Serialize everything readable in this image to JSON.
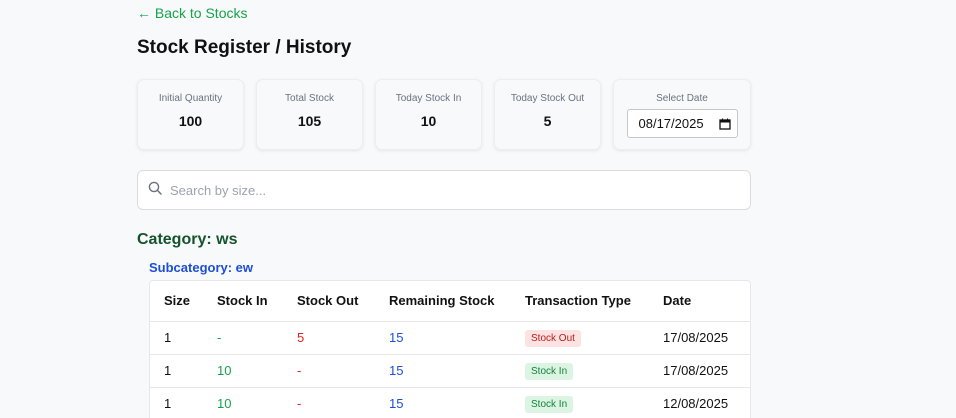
{
  "nav": {
    "back_label": "← Back to Stocks"
  },
  "page": {
    "title": "Stock Register / History"
  },
  "stats": [
    {
      "label": "Initial Quantity",
      "value": "100"
    },
    {
      "label": "Total Stock",
      "value": "105"
    },
    {
      "label": "Today Stock In",
      "value": "10"
    },
    {
      "label": "Today Stock Out",
      "value": "5"
    }
  ],
  "date_picker": {
    "label": "Select Date",
    "value": "08/17/2025",
    "icon": "calendar-icon"
  },
  "search": {
    "placeholder": "Search by size...",
    "icon": "search-icon"
  },
  "category": {
    "label": "Category: ws"
  },
  "subcategory": {
    "label": "Subcategory: ew"
  },
  "table": {
    "headers": [
      "Size",
      "Stock In",
      "Stock Out",
      "Remaining Stock",
      "Transaction Type",
      "Date"
    ],
    "rows": [
      {
        "size": "1",
        "stock_in": "-",
        "stock_out": "5",
        "remaining": "15",
        "type": "Stock Out",
        "date": "17/08/2025"
      },
      {
        "size": "1",
        "stock_in": "10",
        "stock_out": "-",
        "remaining": "15",
        "type": "Stock In",
        "date": "17/08/2025"
      },
      {
        "size": "1",
        "stock_in": "10",
        "stock_out": "-",
        "remaining": "15",
        "type": "Stock In",
        "date": "12/08/2025"
      }
    ]
  },
  "colors": {
    "accent_green": "#16a34a",
    "category_green": "#14532d",
    "link_blue": "#1d4ed8",
    "stock_out_red": "#dc2626",
    "badge_out_bg": "#fde2e2",
    "badge_in_bg": "#dcf5e3"
  }
}
